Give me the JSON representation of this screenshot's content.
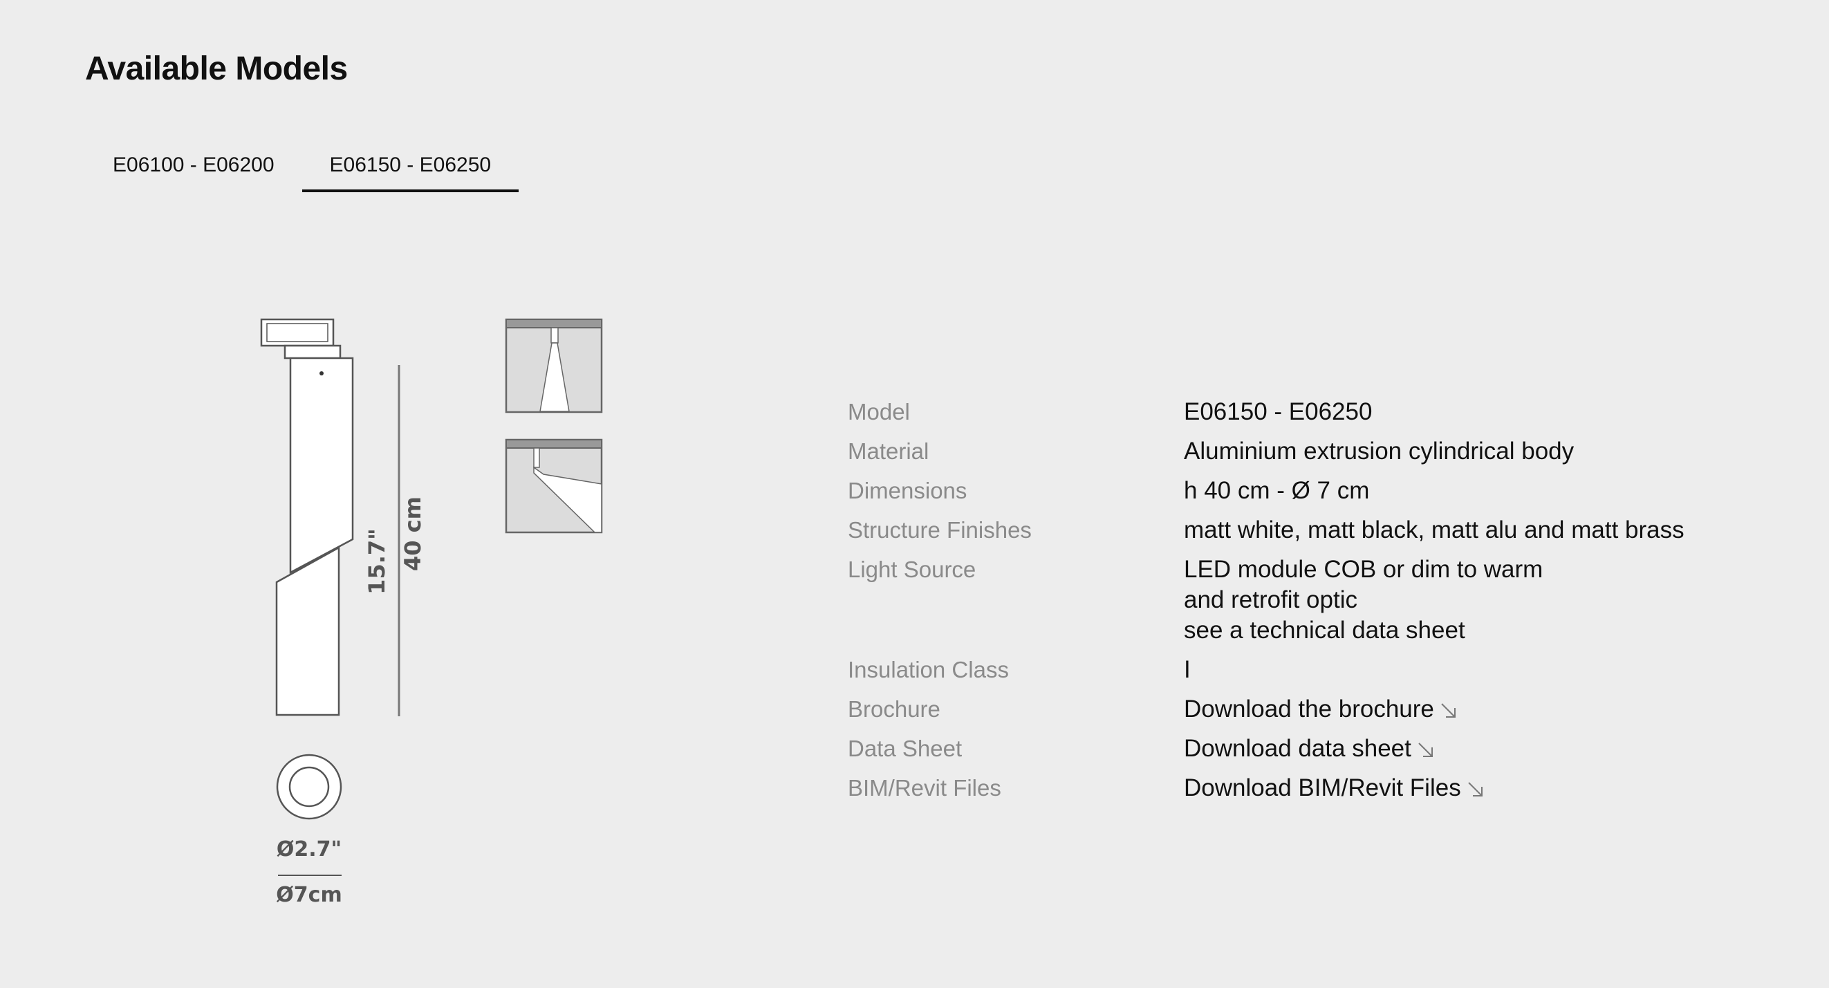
{
  "page": {
    "title": "Available Models"
  },
  "tabs": [
    {
      "label": "E06100 - E06200",
      "active": false
    },
    {
      "label": "E06150 - E06250",
      "active": true
    }
  ],
  "drawing": {
    "height_in": "15.7\"",
    "height_cm": "40 cm",
    "diameter_in": "Ø2.7\"",
    "diameter_cm": "Ø7cm"
  },
  "specs": {
    "model": {
      "label": "Model",
      "value": "E06150 - E06250"
    },
    "material": {
      "label": "Material",
      "value": "Aluminium extrusion cylindrical body"
    },
    "dimensions": {
      "label": "Dimensions",
      "value": "h 40 cm - Ø 7 cm"
    },
    "finishes": {
      "label": "Structure Finishes",
      "value": "matt white, matt black, matt alu and matt brass"
    },
    "light_source": {
      "label": "Light Source",
      "lines": [
        "LED module COB or dim to warm",
        "and retrofit optic",
        "see a technical data sheet"
      ]
    },
    "insulation": {
      "label": "Insulation Class",
      "value": "I"
    },
    "brochure": {
      "label": "Brochure",
      "value": "Download the brochure"
    },
    "data_sheet": {
      "label": "Data Sheet",
      "value": "Download data sheet"
    },
    "bim": {
      "label": "BIM/Revit Files",
      "value": "Download BIM/Revit Files"
    }
  }
}
